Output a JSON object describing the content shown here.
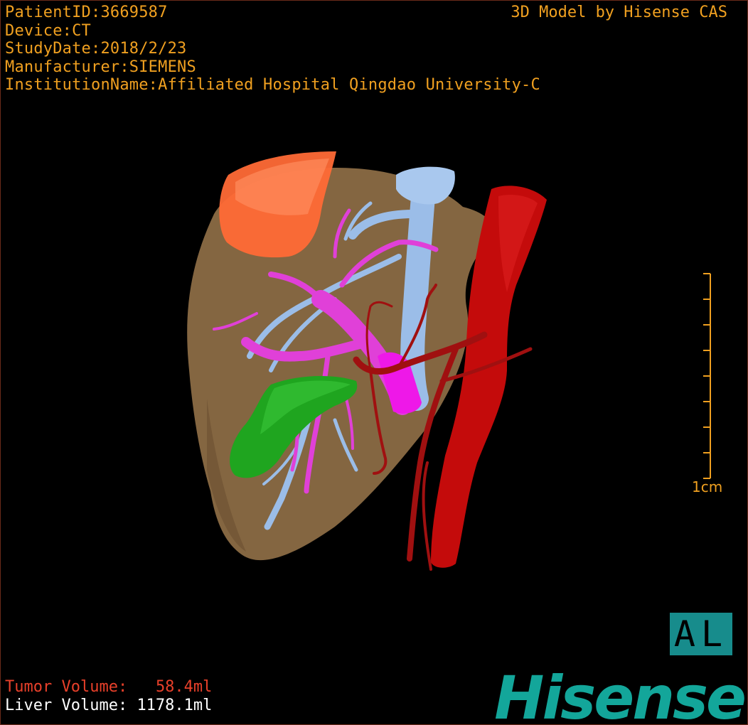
{
  "header": {
    "patient_id": "PatientID:3669587",
    "device": "Device:CT",
    "study_date": "StudyDate:2018/2/23",
    "manufacturer": "Manufacturer:SIEMENS",
    "institution": "InstitutionName:Affiliated Hospital Qingdao University-C",
    "watermark": "3D Model by Hisense CAS"
  },
  "scale_bar": {
    "label": "1cm"
  },
  "orientation_marker": {
    "label": "AL"
  },
  "volumes": {
    "tumor_label": "Tumor Volume:",
    "tumor_value": "58.4ml",
    "liver_label": "Liver Volume:",
    "liver_value": "1178.1ml"
  },
  "brand": {
    "logo_text": "Hisense"
  },
  "model": {
    "icon_names": [
      "liver-model",
      "tumor-model",
      "gallbladder-model",
      "portal-vein-model",
      "hepatic-vein-model",
      "aorta-model",
      "hepatic-artery-model"
    ],
    "colors": {
      "liver": "#8b6b45",
      "tumor": "#ff6a36",
      "gallbladder": "#1fa51f",
      "portal_vein": "#e040d8",
      "hepatic_vein": "#9bbde8",
      "aorta": "#c40b0b",
      "accent_text": "#f0a020"
    }
  }
}
